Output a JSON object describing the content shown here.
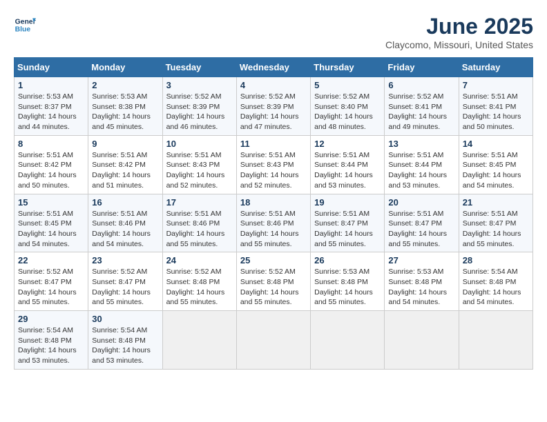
{
  "header": {
    "logo_line1": "General",
    "logo_line2": "Blue",
    "title": "June 2025",
    "subtitle": "Claycomo, Missouri, United States"
  },
  "calendar": {
    "weekdays": [
      "Sunday",
      "Monday",
      "Tuesday",
      "Wednesday",
      "Thursday",
      "Friday",
      "Saturday"
    ],
    "weeks": [
      [
        {
          "day": "1",
          "info": "Sunrise: 5:53 AM\nSunset: 8:37 PM\nDaylight: 14 hours\nand 44 minutes."
        },
        {
          "day": "2",
          "info": "Sunrise: 5:53 AM\nSunset: 8:38 PM\nDaylight: 14 hours\nand 45 minutes."
        },
        {
          "day": "3",
          "info": "Sunrise: 5:52 AM\nSunset: 8:39 PM\nDaylight: 14 hours\nand 46 minutes."
        },
        {
          "day": "4",
          "info": "Sunrise: 5:52 AM\nSunset: 8:39 PM\nDaylight: 14 hours\nand 47 minutes."
        },
        {
          "day": "5",
          "info": "Sunrise: 5:52 AM\nSunset: 8:40 PM\nDaylight: 14 hours\nand 48 minutes."
        },
        {
          "day": "6",
          "info": "Sunrise: 5:52 AM\nSunset: 8:41 PM\nDaylight: 14 hours\nand 49 minutes."
        },
        {
          "day": "7",
          "info": "Sunrise: 5:51 AM\nSunset: 8:41 PM\nDaylight: 14 hours\nand 50 minutes."
        }
      ],
      [
        {
          "day": "8",
          "info": "Sunrise: 5:51 AM\nSunset: 8:42 PM\nDaylight: 14 hours\nand 50 minutes."
        },
        {
          "day": "9",
          "info": "Sunrise: 5:51 AM\nSunset: 8:42 PM\nDaylight: 14 hours\nand 51 minutes."
        },
        {
          "day": "10",
          "info": "Sunrise: 5:51 AM\nSunset: 8:43 PM\nDaylight: 14 hours\nand 52 minutes."
        },
        {
          "day": "11",
          "info": "Sunrise: 5:51 AM\nSunset: 8:43 PM\nDaylight: 14 hours\nand 52 minutes."
        },
        {
          "day": "12",
          "info": "Sunrise: 5:51 AM\nSunset: 8:44 PM\nDaylight: 14 hours\nand 53 minutes."
        },
        {
          "day": "13",
          "info": "Sunrise: 5:51 AM\nSunset: 8:44 PM\nDaylight: 14 hours\nand 53 minutes."
        },
        {
          "day": "14",
          "info": "Sunrise: 5:51 AM\nSunset: 8:45 PM\nDaylight: 14 hours\nand 54 minutes."
        }
      ],
      [
        {
          "day": "15",
          "info": "Sunrise: 5:51 AM\nSunset: 8:45 PM\nDaylight: 14 hours\nand 54 minutes."
        },
        {
          "day": "16",
          "info": "Sunrise: 5:51 AM\nSunset: 8:46 PM\nDaylight: 14 hours\nand 54 minutes."
        },
        {
          "day": "17",
          "info": "Sunrise: 5:51 AM\nSunset: 8:46 PM\nDaylight: 14 hours\nand 55 minutes."
        },
        {
          "day": "18",
          "info": "Sunrise: 5:51 AM\nSunset: 8:46 PM\nDaylight: 14 hours\nand 55 minutes."
        },
        {
          "day": "19",
          "info": "Sunrise: 5:51 AM\nSunset: 8:47 PM\nDaylight: 14 hours\nand 55 minutes."
        },
        {
          "day": "20",
          "info": "Sunrise: 5:51 AM\nSunset: 8:47 PM\nDaylight: 14 hours\nand 55 minutes."
        },
        {
          "day": "21",
          "info": "Sunrise: 5:51 AM\nSunset: 8:47 PM\nDaylight: 14 hours\nand 55 minutes."
        }
      ],
      [
        {
          "day": "22",
          "info": "Sunrise: 5:52 AM\nSunset: 8:47 PM\nDaylight: 14 hours\nand 55 minutes."
        },
        {
          "day": "23",
          "info": "Sunrise: 5:52 AM\nSunset: 8:47 PM\nDaylight: 14 hours\nand 55 minutes."
        },
        {
          "day": "24",
          "info": "Sunrise: 5:52 AM\nSunset: 8:48 PM\nDaylight: 14 hours\nand 55 minutes."
        },
        {
          "day": "25",
          "info": "Sunrise: 5:52 AM\nSunset: 8:48 PM\nDaylight: 14 hours\nand 55 minutes."
        },
        {
          "day": "26",
          "info": "Sunrise: 5:53 AM\nSunset: 8:48 PM\nDaylight: 14 hours\nand 55 minutes."
        },
        {
          "day": "27",
          "info": "Sunrise: 5:53 AM\nSunset: 8:48 PM\nDaylight: 14 hours\nand 54 minutes."
        },
        {
          "day": "28",
          "info": "Sunrise: 5:54 AM\nSunset: 8:48 PM\nDaylight: 14 hours\nand 54 minutes."
        }
      ],
      [
        {
          "day": "29",
          "info": "Sunrise: 5:54 AM\nSunset: 8:48 PM\nDaylight: 14 hours\nand 53 minutes."
        },
        {
          "day": "30",
          "info": "Sunrise: 5:54 AM\nSunset: 8:48 PM\nDaylight: 14 hours\nand 53 minutes."
        },
        {
          "day": "",
          "info": ""
        },
        {
          "day": "",
          "info": ""
        },
        {
          "day": "",
          "info": ""
        },
        {
          "day": "",
          "info": ""
        },
        {
          "day": "",
          "info": ""
        }
      ]
    ]
  }
}
